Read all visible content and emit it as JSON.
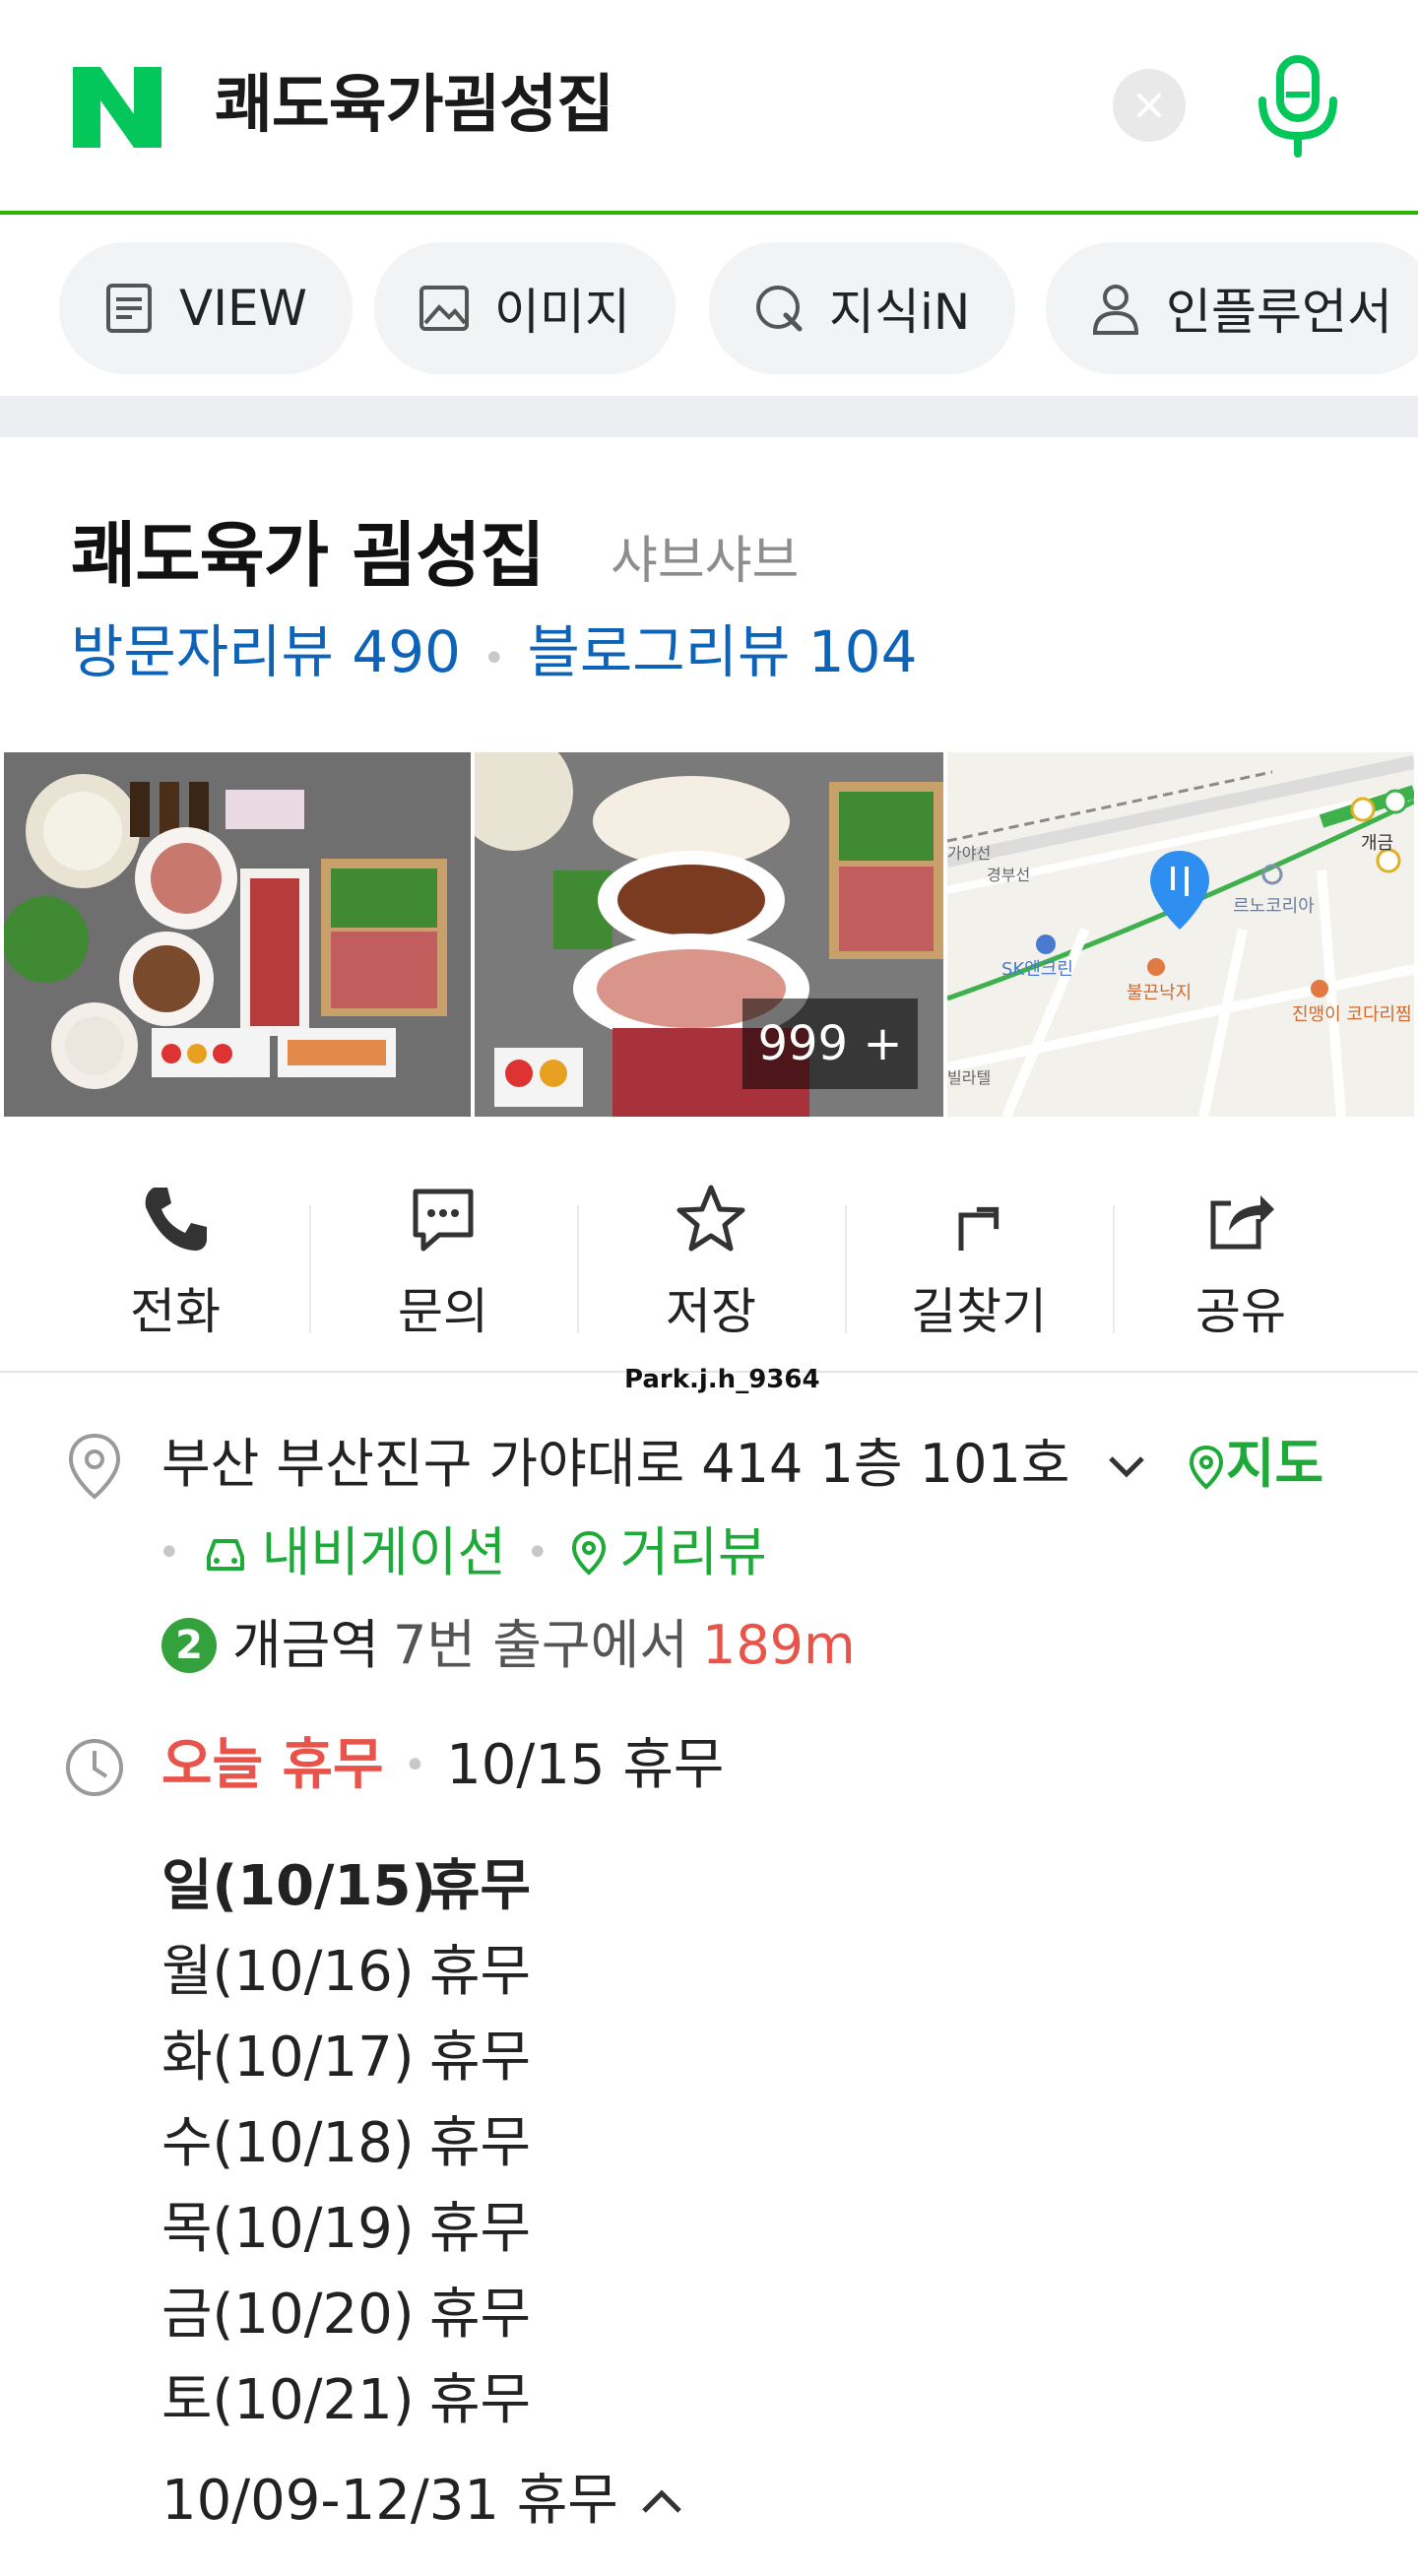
{
  "search": {
    "query": "쾌도육가굄성집"
  },
  "tabs": [
    {
      "label": "VIEW",
      "icon": "document-icon"
    },
    {
      "label": "이미지",
      "icon": "image-icon"
    },
    {
      "label": "지식iN",
      "icon": "q-icon"
    },
    {
      "label": "인플루언서",
      "icon": "person-icon"
    }
  ],
  "place": {
    "name": "쾌도육가 굄성집",
    "category": "샤브샤브",
    "visitor_reviews": "방문자리뷰 490",
    "blog_reviews": "블로그리뷰 104",
    "photo_count": "999 +",
    "map_labels": {
      "gayaseon": "가야선",
      "gyeongbuseon": "경부선",
      "lenokorea": "르노코리아",
      "sk": "SK엔크린",
      "bulgeun": "불끈낙지",
      "jinmaengi": "진맹이 코다리찜",
      "gaegeum": "개금",
      "villa": "빌라텔"
    }
  },
  "actions": [
    {
      "label": "전화",
      "icon": "phone-icon"
    },
    {
      "label": "문의",
      "icon": "chat-icon"
    },
    {
      "label": "저장",
      "icon": "star-icon"
    },
    {
      "label": "길찾기",
      "icon": "directions-icon"
    },
    {
      "label": "공유",
      "icon": "share-icon"
    }
  ],
  "watermark": "Park.j.h_9364",
  "address": {
    "text": "부산 부산진구 가야대로 414 1층 101호",
    "map_link": "지도",
    "navigation_link": "내비게이션",
    "streetview_link": "거리뷰",
    "line_number": "2",
    "station": "개금역",
    "exit_text": "7번 출구에서",
    "distance": "189m"
  },
  "hours": {
    "status": "오늘 휴무",
    "summary": "10/15 휴무",
    "schedule": [
      {
        "day": "일(10/15)",
        "status": "휴무"
      },
      {
        "day": "월(10/16)",
        "status": "휴무"
      },
      {
        "day": "화(10/17)",
        "status": "휴무"
      },
      {
        "day": "수(10/18)",
        "status": "휴무"
      },
      {
        "day": "목(10/19)",
        "status": "휴무"
      },
      {
        "day": "금(10/20)",
        "status": "휴무"
      },
      {
        "day": "토(10/21)",
        "status": "휴무"
      }
    ],
    "period": "10/09-12/31 휴무"
  },
  "colors": {
    "naver_green": "#03c75a",
    "link_green": "#1eaa39",
    "review_blue": "#0c63b8",
    "closed_red": "#e8534a",
    "line2_green": "#33a23d"
  }
}
